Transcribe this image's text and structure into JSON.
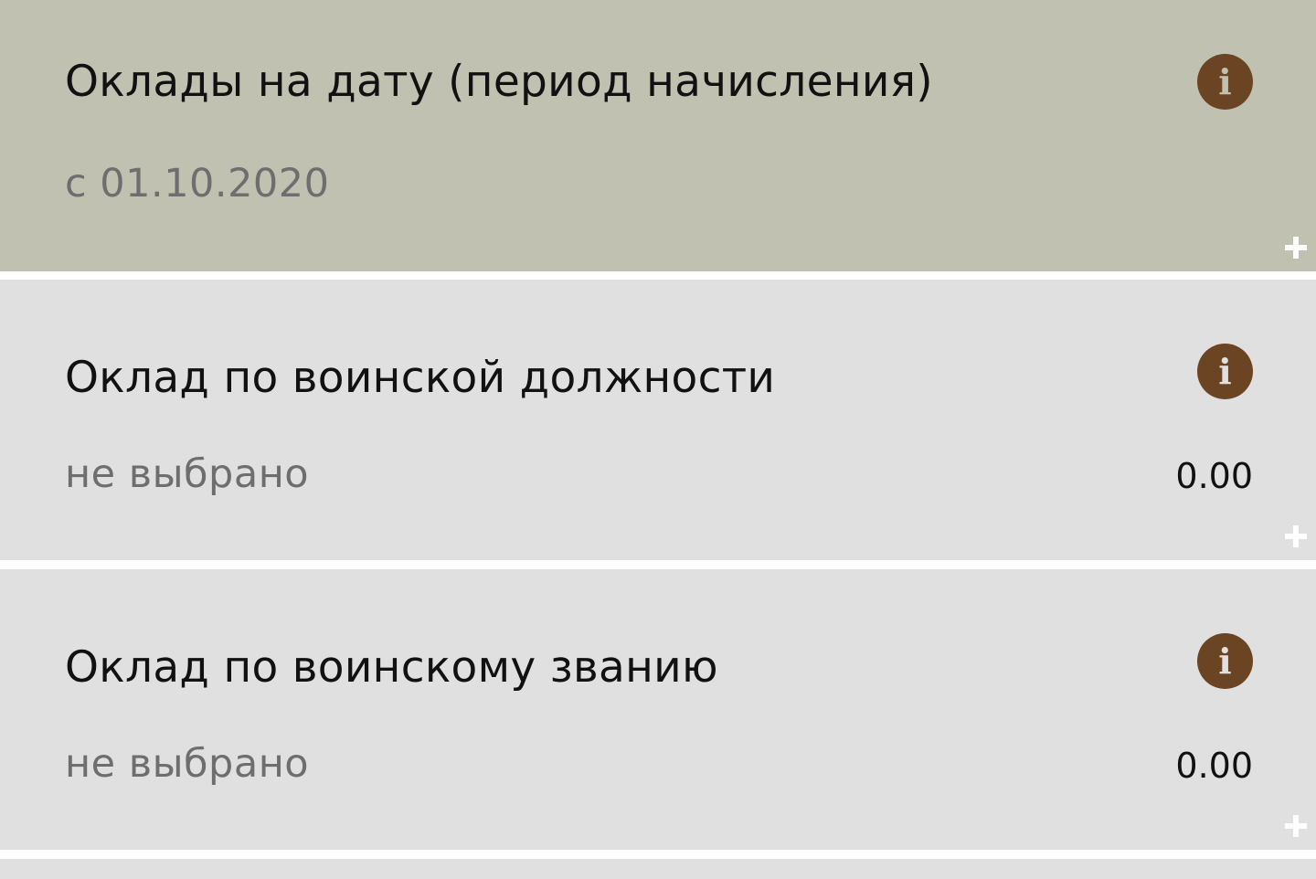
{
  "period": {
    "title": "Оклады на дату (период начисления)",
    "value": "с 01.10.2020",
    "info_icon": "info-icon",
    "expand_icon": "plus-icon"
  },
  "items": [
    {
      "title": "Оклад по воинской должности",
      "value": "не выбрано",
      "amount": "0.00",
      "info_icon": "info-icon",
      "expand_icon": "plus-icon"
    },
    {
      "title": "Оклад по воинскому званию",
      "value": "не выбрано",
      "amount": "0.00",
      "info_icon": "info-icon",
      "expand_icon": "plus-icon"
    }
  ],
  "info_glyph": "i",
  "colors": {
    "period_bg": "#c0c1b0",
    "card_bg": "#e0e0e0",
    "info_icon_bg": "#6b4423",
    "muted_text": "#6e6e6e"
  }
}
